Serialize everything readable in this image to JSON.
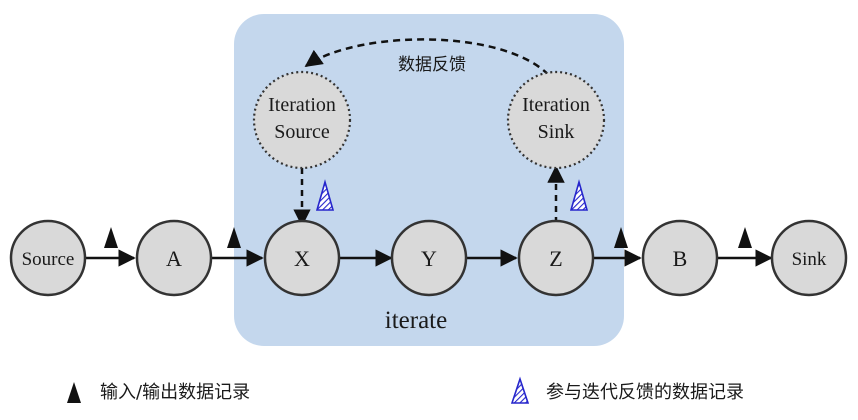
{
  "diagram": {
    "region_label": "iterate",
    "feedback_label": "数据反馈",
    "nodes": {
      "source": "Source",
      "a": "A",
      "x": "X",
      "y": "Y",
      "z": "Z",
      "b": "B",
      "sink": "Sink",
      "iteration_source": {
        "line1": "Iteration",
        "line2": "Source"
      },
      "iteration_sink": {
        "line1": "Iteration",
        "line2": "Sink"
      }
    },
    "edges": [
      {
        "from": "source",
        "to": "a",
        "style": "solid",
        "marker": "input-output-record"
      },
      {
        "from": "a",
        "to": "x",
        "style": "solid",
        "marker": "input-output-record"
      },
      {
        "from": "x",
        "to": "y",
        "style": "solid"
      },
      {
        "from": "y",
        "to": "z",
        "style": "solid"
      },
      {
        "from": "z",
        "to": "b",
        "style": "solid",
        "marker": "input-output-record"
      },
      {
        "from": "b",
        "to": "sink",
        "style": "solid",
        "marker": "input-output-record"
      },
      {
        "from": "iteration_source",
        "to": "x",
        "style": "dashed",
        "marker": "iteration-feedback-record"
      },
      {
        "from": "z",
        "to": "iteration_sink",
        "style": "dashed",
        "marker": "iteration-feedback-record"
      },
      {
        "from": "iteration_sink",
        "to": "iteration_source",
        "style": "dashed-curve",
        "label": "数据反馈"
      }
    ],
    "colors": {
      "region_fill": "#c4d7ed",
      "node_fill": "#d9d9d9",
      "node_stroke": "#333333",
      "solid_marker": "#111111",
      "hatched_marker": "#2626cc"
    }
  },
  "legend": {
    "io_record_label": "输入/输出数据记录",
    "feedback_record_label": "参与迭代反馈的数据记录"
  }
}
